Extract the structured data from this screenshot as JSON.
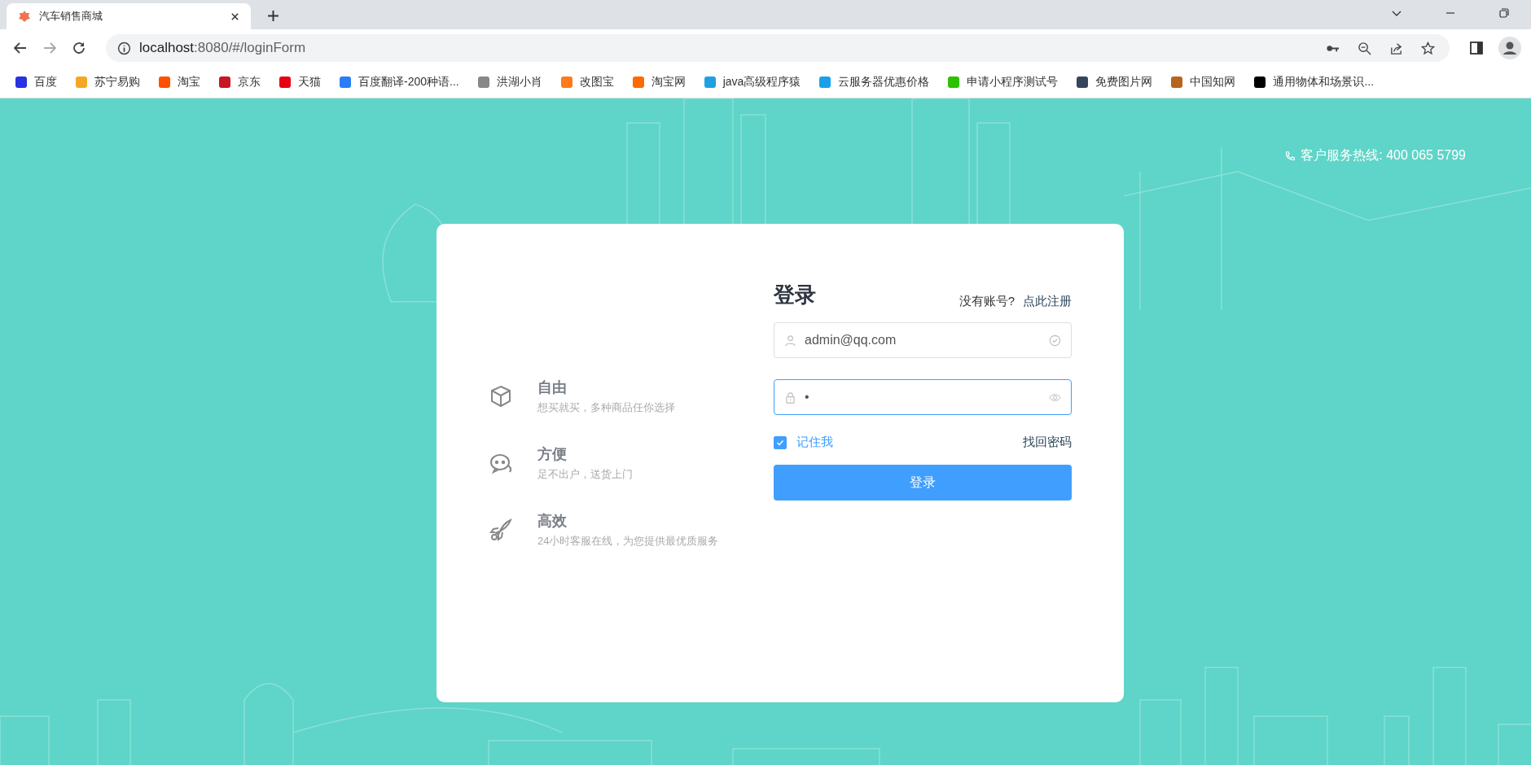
{
  "browser": {
    "tab": {
      "title": "汽车销售商城"
    },
    "address": {
      "host": "localhost",
      "path": ":8080/#/loginForm"
    },
    "bookmarks": [
      {
        "label": "百度",
        "color": "#2932e1"
      },
      {
        "label": "苏宁易购",
        "color": "#f5a623"
      },
      {
        "label": "淘宝",
        "color": "#ff5000"
      },
      {
        "label": "京东",
        "color": "#c81623"
      },
      {
        "label": "天猫",
        "color": "#e60012"
      },
      {
        "label": "百度翻译-200种语...",
        "color": "#2b7cf6"
      },
      {
        "label": "洪湖小肖",
        "color": "#888888"
      },
      {
        "label": "改图宝",
        "color": "#ff7a1a"
      },
      {
        "label": "淘宝网",
        "color": "#ff6a00"
      },
      {
        "label": "java高级程序猿",
        "color": "#1fa1e0"
      },
      {
        "label": "云服务器优惠价格",
        "color": "#1aa0e8"
      },
      {
        "label": "申请小程序测试号",
        "color": "#2dc100"
      },
      {
        "label": "免费图片网",
        "color": "#35465c"
      },
      {
        "label": "中国知网",
        "color": "#b5651d"
      },
      {
        "label": "通用物体和场景识...",
        "color": "#000000"
      }
    ]
  },
  "hotline": "客户服务热线: 400 065 5799",
  "features": [
    {
      "kind": "box",
      "title": "自由",
      "desc": "想买就买，多种商品任你选择"
    },
    {
      "kind": "chat",
      "title": "方便",
      "desc": "足不出户，送货上门"
    },
    {
      "kind": "rocket",
      "title": "高效",
      "desc": "24小时客服在线，为您提供最优质服务"
    }
  ],
  "login": {
    "title": "登录",
    "no_account": "没有账号?",
    "register_link": "点此注册",
    "fields": [
      {
        "kind": "user",
        "value": "admin@qq.com",
        "focused": false,
        "valid": true
      },
      {
        "kind": "password",
        "value": "•",
        "focused": true,
        "valid": false
      }
    ],
    "remember": {
      "label": "记住我",
      "checked": true
    },
    "forgot": "找回密码",
    "submit": "登录"
  }
}
